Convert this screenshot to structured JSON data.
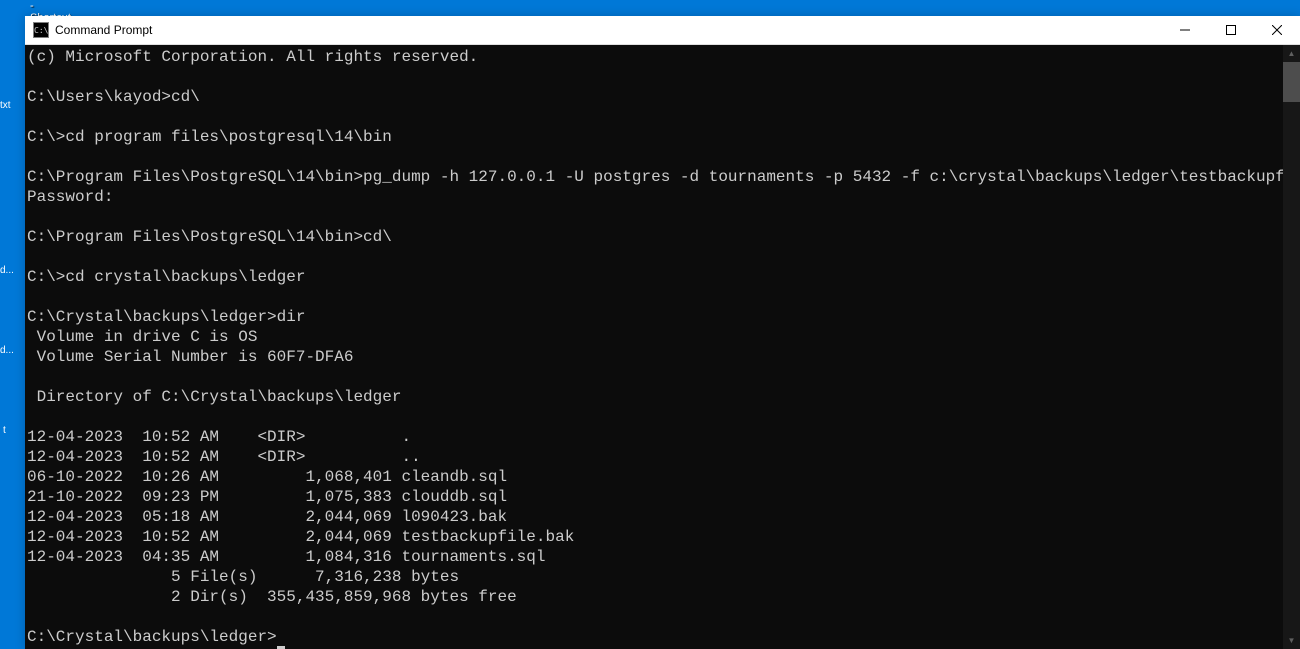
{
  "desktop": {
    "shortcut_label": "- Shortcut",
    "icon_txt": "txt",
    "icon_d1": "d...",
    "icon_d2": "d...",
    "icon_t": "t"
  },
  "window": {
    "title": "Command Prompt",
    "icon_text": "C:\\"
  },
  "terminal": {
    "lines": [
      "(c) Microsoft Corporation. All rights reserved.",
      "",
      "C:\\Users\\kayod>cd\\",
      "",
      "C:\\>cd program files\\postgresql\\14\\bin",
      "",
      "C:\\Program Files\\PostgreSQL\\14\\bin>pg_dump -h 127.0.0.1 -U postgres -d tournaments -p 5432 -f c:\\crystal\\backups\\ledger\\testbackupfile.bak",
      "Password:",
      "",
      "C:\\Program Files\\PostgreSQL\\14\\bin>cd\\",
      "",
      "C:\\>cd crystal\\backups\\ledger",
      "",
      "C:\\Crystal\\backups\\ledger>dir",
      " Volume in drive C is OS",
      " Volume Serial Number is 60F7-DFA6",
      "",
      " Directory of C:\\Crystal\\backups\\ledger",
      "",
      "12-04-2023  10:52 AM    <DIR>          .",
      "12-04-2023  10:52 AM    <DIR>          ..",
      "06-10-2022  10:26 AM         1,068,401 cleandb.sql",
      "21-10-2022  09:23 PM         1,075,383 clouddb.sql",
      "12-04-2023  05:18 AM         2,044,069 l090423.bak",
      "12-04-2023  10:52 AM         2,044,069 testbackupfile.bak",
      "12-04-2023  04:35 AM         1,084,316 tournaments.sql",
      "               5 File(s)      7,316,238 bytes",
      "               2 Dir(s)  355,435,859,968 bytes free",
      "",
      "C:\\Crystal\\backups\\ledger>"
    ]
  }
}
